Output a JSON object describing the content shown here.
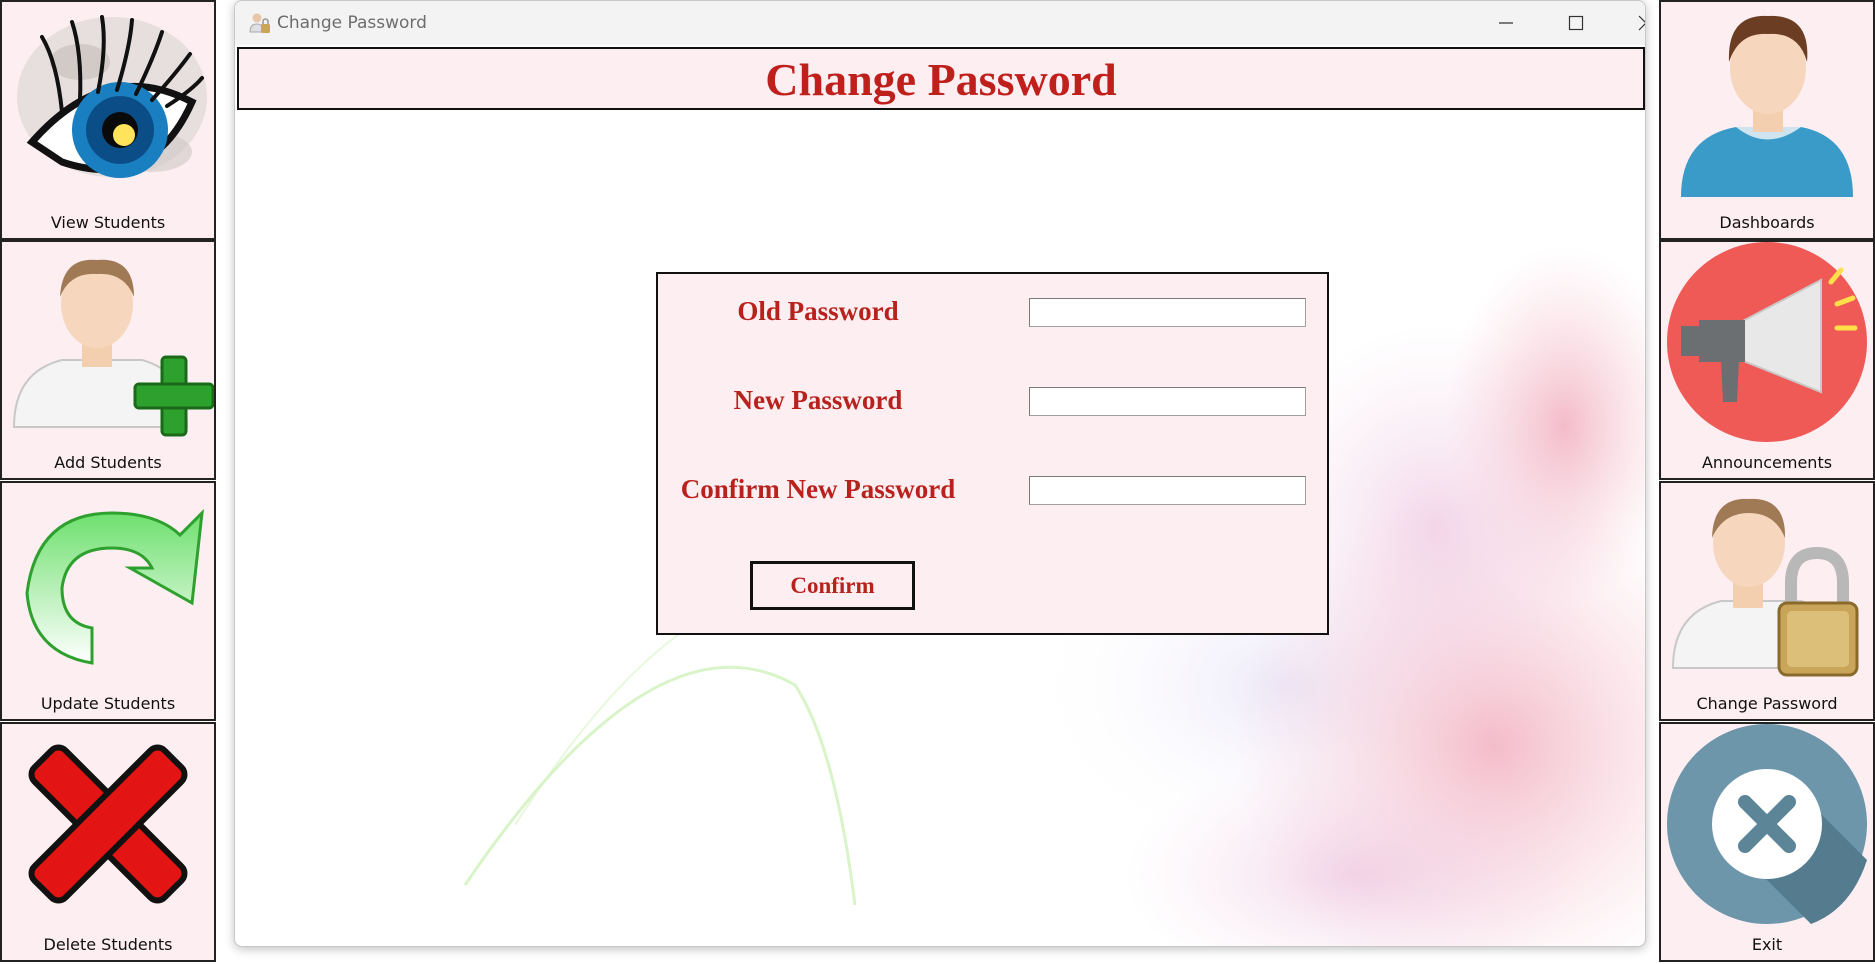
{
  "window": {
    "title": "Change Password",
    "header_title": "Change Password"
  },
  "left_nav": [
    {
      "label": "View Students",
      "icon": "eye-icon"
    },
    {
      "label": "Add Students",
      "icon": "add-user-icon"
    },
    {
      "label": "Update Students",
      "icon": "refresh-arrow-icon"
    },
    {
      "label": "Delete Students",
      "icon": "red-x-icon"
    }
  ],
  "right_nav": [
    {
      "label": "Dashboards",
      "icon": "user-avatar-icon"
    },
    {
      "label": "Announcements",
      "icon": "megaphone-icon"
    },
    {
      "label": "Change Password",
      "icon": "user-lock-icon"
    },
    {
      "label": "Exit",
      "icon": "exit-circle-icon"
    }
  ],
  "form": {
    "old_password_label": "Old Password",
    "old_password_value": "",
    "new_password_label": "New Password",
    "new_password_value": "",
    "confirm_password_label": "Confirm New Password",
    "confirm_password_value": "",
    "confirm_button_label": "Confirm"
  },
  "colors": {
    "accent_red": "#c0201c",
    "panel_pink": "#fdeef2"
  }
}
